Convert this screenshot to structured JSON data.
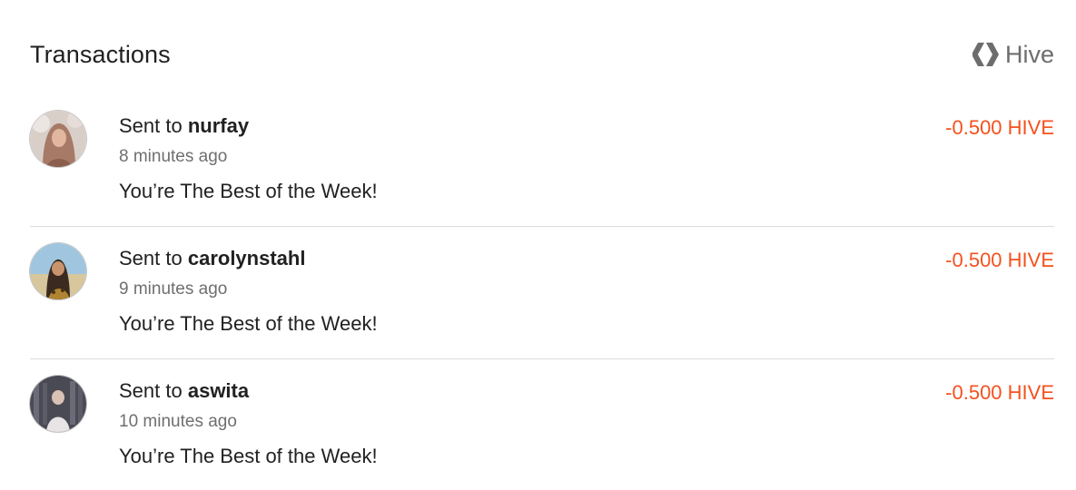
{
  "header": {
    "title": "Transactions",
    "currency_label": "Hive",
    "currency_icon": "hive-logo-icon"
  },
  "colors": {
    "amount_negative": "#f4511e",
    "divider": "#dcdcdc",
    "muted_text": "#6f6f6f"
  },
  "transactions": [
    {
      "prefix": "Sent to ",
      "user": "nurfay",
      "time": "8 minutes ago",
      "memo": "You’re The Best of the Week!",
      "amount": "-0.500 HIVE"
    },
    {
      "prefix": "Sent to ",
      "user": "carolynstahl",
      "time": "9 minutes ago",
      "memo": "You’re The Best of the Week!",
      "amount": "-0.500 HIVE"
    },
    {
      "prefix": "Sent to ",
      "user": "aswita",
      "time": "10 minutes ago",
      "memo": "You’re The Best of the Week!",
      "amount": "-0.500 HIVE"
    }
  ]
}
